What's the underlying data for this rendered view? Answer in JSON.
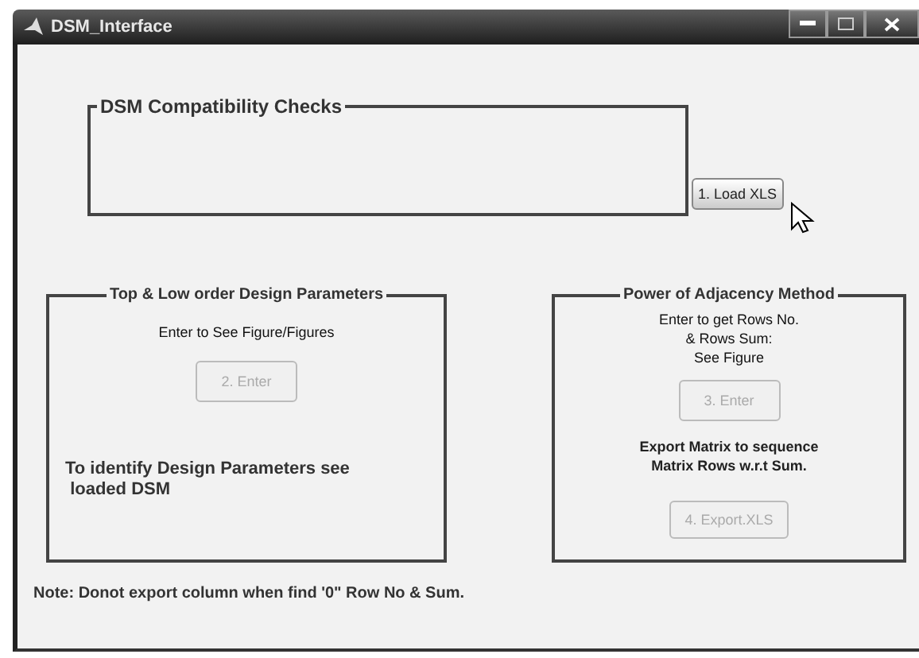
{
  "window": {
    "title": "DSM_Interface"
  },
  "compatibility_group": {
    "title": "DSM Compatibility Checks"
  },
  "load_button": {
    "label": "1. Load XLS",
    "disabled": false
  },
  "left_panel": {
    "title": "Top & Low order Design Parameters",
    "instruction": "Enter to See Figure/Figures",
    "button": {
      "label": "2. Enter",
      "disabled": true
    },
    "info": "To identify Design Parameters see\n loaded DSM"
  },
  "right_panel": {
    "title": "Power of Adjacency Method",
    "instruction": "Enter to get Rows No.\n& Rows Sum:\nSee Figure",
    "button": {
      "label": "3. Enter",
      "disabled": true
    },
    "info": "Export Matrix to sequence\nMatrix Rows w.r.t Sum.",
    "export_button": {
      "label": "4. Export.XLS",
      "disabled": true
    }
  },
  "note": "Note: Donot export column when find '0\" Row No & Sum."
}
